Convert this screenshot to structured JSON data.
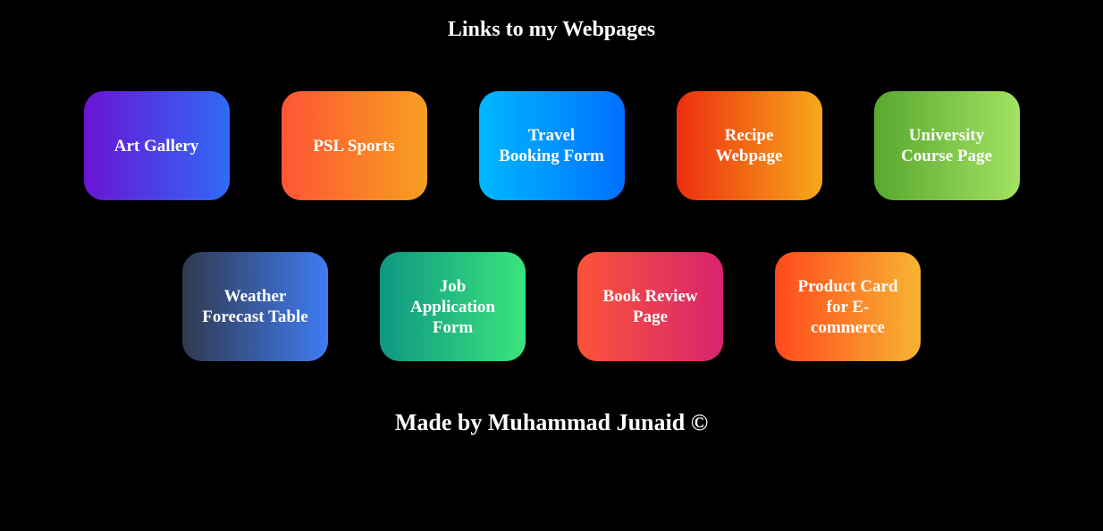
{
  "page": {
    "title": "Links to my Webpages",
    "footer": "Made by Muhammad Junaid ©"
  },
  "links": [
    {
      "label": "Art Gallery"
    },
    {
      "label": "PSL Sports"
    },
    {
      "label": "Travel Booking Form"
    },
    {
      "label": "Recipe Webpage"
    },
    {
      "label": "University Course Page"
    },
    {
      "label": "Weather Forecast Table"
    },
    {
      "label": "Job Application Form"
    },
    {
      "label": "Book Review Page"
    },
    {
      "label": "Product Card for E-commerce"
    }
  ],
  "colors": {
    "background": "#000000",
    "text": "#ffffff",
    "art_gallery": [
      "#6a14d4",
      "#2f6bf6"
    ],
    "psl_sports": [
      "#ff5534",
      "#f6a020"
    ],
    "travel_booking": [
      "#00b8ff",
      "#0070ff"
    ],
    "recipe": [
      "#ec2f10",
      "#f7a91a"
    ],
    "university": [
      "#58a82f",
      "#a3e262"
    ],
    "weather": [
      "#303a4e",
      "#3f7cf2"
    ],
    "job_application": [
      "#0f9783",
      "#3ae57c"
    ],
    "book_review": [
      "#fb5437",
      "#d8246f"
    ],
    "product_card": [
      "#ff4a1c",
      "#f8b432"
    ]
  }
}
